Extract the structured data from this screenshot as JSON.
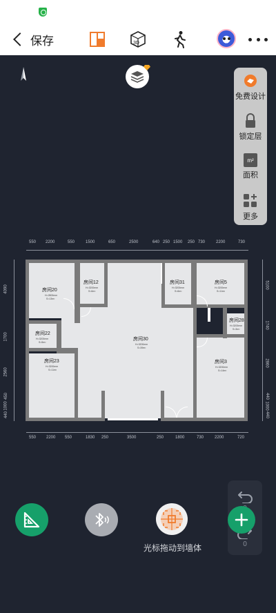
{
  "toolbar": {
    "back_label": "保存",
    "icons": [
      "floorplan-icon",
      "3d-view-icon",
      "walk-mode-icon",
      "avatar",
      "more-icon"
    ]
  },
  "side_panel": {
    "items": [
      {
        "label": "免费设计",
        "icon": "design-service-icon"
      },
      {
        "label": "锁定层",
        "icon": "lock-icon"
      },
      {
        "label": "面积",
        "icon": "area-icon",
        "badge": "m²"
      },
      {
        "label": "更多",
        "icon": "more-grid-icon"
      }
    ]
  },
  "dimensions": {
    "top": [
      "550",
      "2200",
      "550",
      "1500",
      "650",
      "2500",
      "640",
      "250",
      "1500",
      "250",
      "730",
      "2200",
      "730"
    ],
    "bottom": [
      "550",
      "2200",
      "550",
      "1830",
      "250",
      "3500",
      "250",
      "1800",
      "730",
      "2200",
      "720"
    ],
    "left": [
      "4090",
      "1700",
      "2560",
      "450",
      "1000",
      "440"
    ],
    "right": [
      "5100",
      "1740",
      "2860",
      "440",
      "1000",
      "440"
    ]
  },
  "rooms": [
    {
      "name": "房间20",
      "line1": "H=2800mm",
      "line2": "S=13m²"
    },
    {
      "name": "房间12",
      "line1": "H=3200mm",
      "line2": "S=6m²"
    },
    {
      "name": "房间31",
      "line1": "H=3200mm",
      "line2": "S=6m²"
    },
    {
      "name": "房间5",
      "line1": "H=3200mm",
      "line2": "S=11m²"
    },
    {
      "name": "房间28",
      "line1": "H=3200mm",
      "line2": "S=3m²"
    },
    {
      "name": "房间22",
      "line1": "H=3200mm",
      "line2": "S=5m²"
    },
    {
      "name": "房间30",
      "line1": "H=3200mm",
      "line2": "S=39m²"
    },
    {
      "name": "房间23",
      "line1": "H=3200mm",
      "line2": "S=11m²"
    },
    {
      "name": "房间3",
      "line1": "H=3200mm",
      "line2": "S=14m²"
    }
  ],
  "undo": {
    "count": "0"
  },
  "redo": {
    "count": "0"
  },
  "bottom": {
    "cursor_hint": "光标拖动到墙体"
  },
  "colors": {
    "accent_orange": "#f07b2c",
    "green": "#16a06a",
    "canvas_bg": "#1f2430",
    "wall": "#7a7a7a",
    "room_fill": "#e6e7e9"
  }
}
